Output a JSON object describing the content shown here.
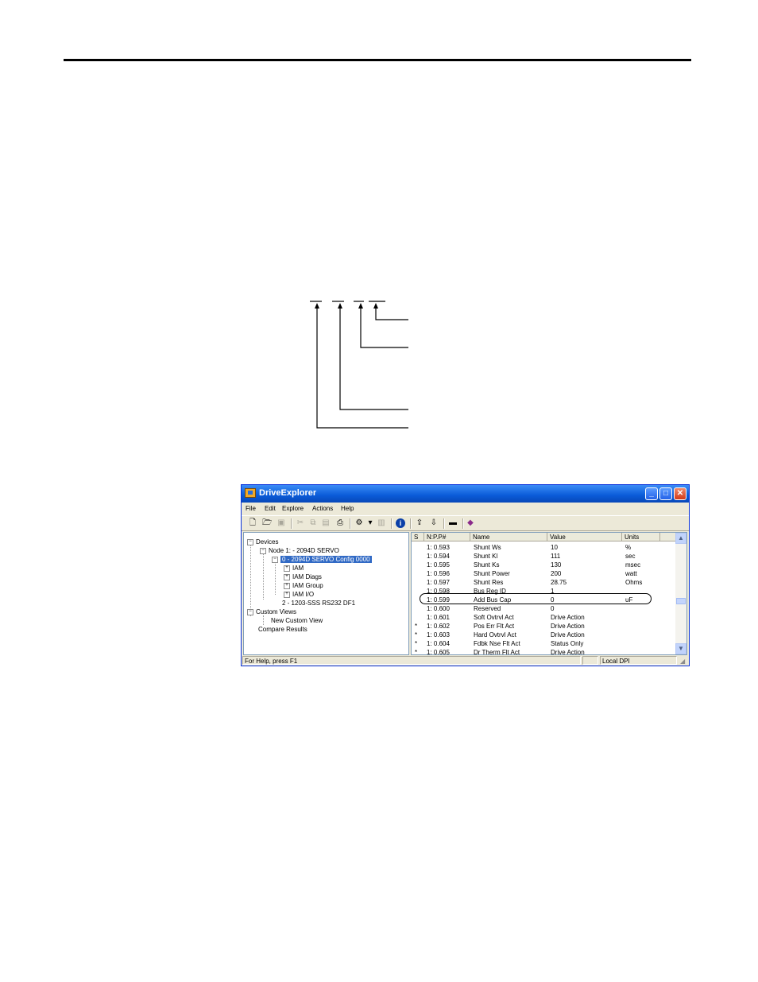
{
  "window": {
    "title": "DriveExplorer",
    "buttons": {
      "minimize": "_",
      "maximize": "□",
      "close": "✕"
    }
  },
  "menu": [
    "File",
    "Edit",
    "Explore",
    "Actions",
    "Help"
  ],
  "tree": {
    "devices": "Devices",
    "node1": "Node 1: - 2094D SERVO",
    "config": "0 - 2094D SERVO Config 0000",
    "iam": "IAM",
    "iam_diags": "IAM Diags",
    "iam_group": "IAM Group",
    "iam_io": "IAM I/O",
    "node2": "2 - 1203-SSS RS232 DF1",
    "custom_views": "Custom Views",
    "new_custom_view": "New Custom View",
    "compare_results": "Compare Results"
  },
  "columns": [
    "S",
    "N:P.P#",
    "Name",
    "Value",
    "Units"
  ],
  "rows": [
    {
      "s": "",
      "np": "1: 0.593",
      "name": "Shunt Ws",
      "value": "10",
      "units": "%"
    },
    {
      "s": "",
      "np": "1: 0.594",
      "name": "Shunt Kl",
      "value": "111",
      "units": "sec"
    },
    {
      "s": "",
      "np": "1: 0.595",
      "name": "Shunt Ks",
      "value": "130",
      "units": "msec"
    },
    {
      "s": "",
      "np": "1: 0.596",
      "name": "Shunt Power",
      "value": "200",
      "units": "watt"
    },
    {
      "s": "",
      "np": "1: 0.597",
      "name": "Shunt Res",
      "value": "28.75",
      "units": "Ohms"
    },
    {
      "s": "",
      "np": "1: 0.598",
      "name": "Bus Reg ID",
      "value": "1",
      "units": ""
    },
    {
      "s": "",
      "np": "1: 0.599",
      "name": "Add Bus Cap",
      "value": "0",
      "units": "uF"
    },
    {
      "s": "",
      "np": "1: 0.600",
      "name": "Reserved",
      "value": "0",
      "units": ""
    },
    {
      "s": "",
      "np": "1: 0.601",
      "name": "Soft Ovtrvl Act",
      "value": "Drive Action",
      "units": ""
    },
    {
      "s": "*",
      "np": "1: 0.602",
      "name": "Pos Err Flt Act",
      "value": "Drive Action",
      "units": ""
    },
    {
      "s": "*",
      "np": "1: 0.603",
      "name": "Hard Ovtrvl Act",
      "value": "Drive Action",
      "units": ""
    },
    {
      "s": "*",
      "np": "1: 0.604",
      "name": "Fdbk Nse Flt Act",
      "value": "Status Only",
      "units": ""
    },
    {
      "s": "*",
      "np": "1: 0.605",
      "name": "Dr Therm Flt Act",
      "value": "Drive Action",
      "units": ""
    }
  ],
  "status": {
    "help": "For Help, press F1",
    "mid": "",
    "conn": "Local DPI"
  }
}
